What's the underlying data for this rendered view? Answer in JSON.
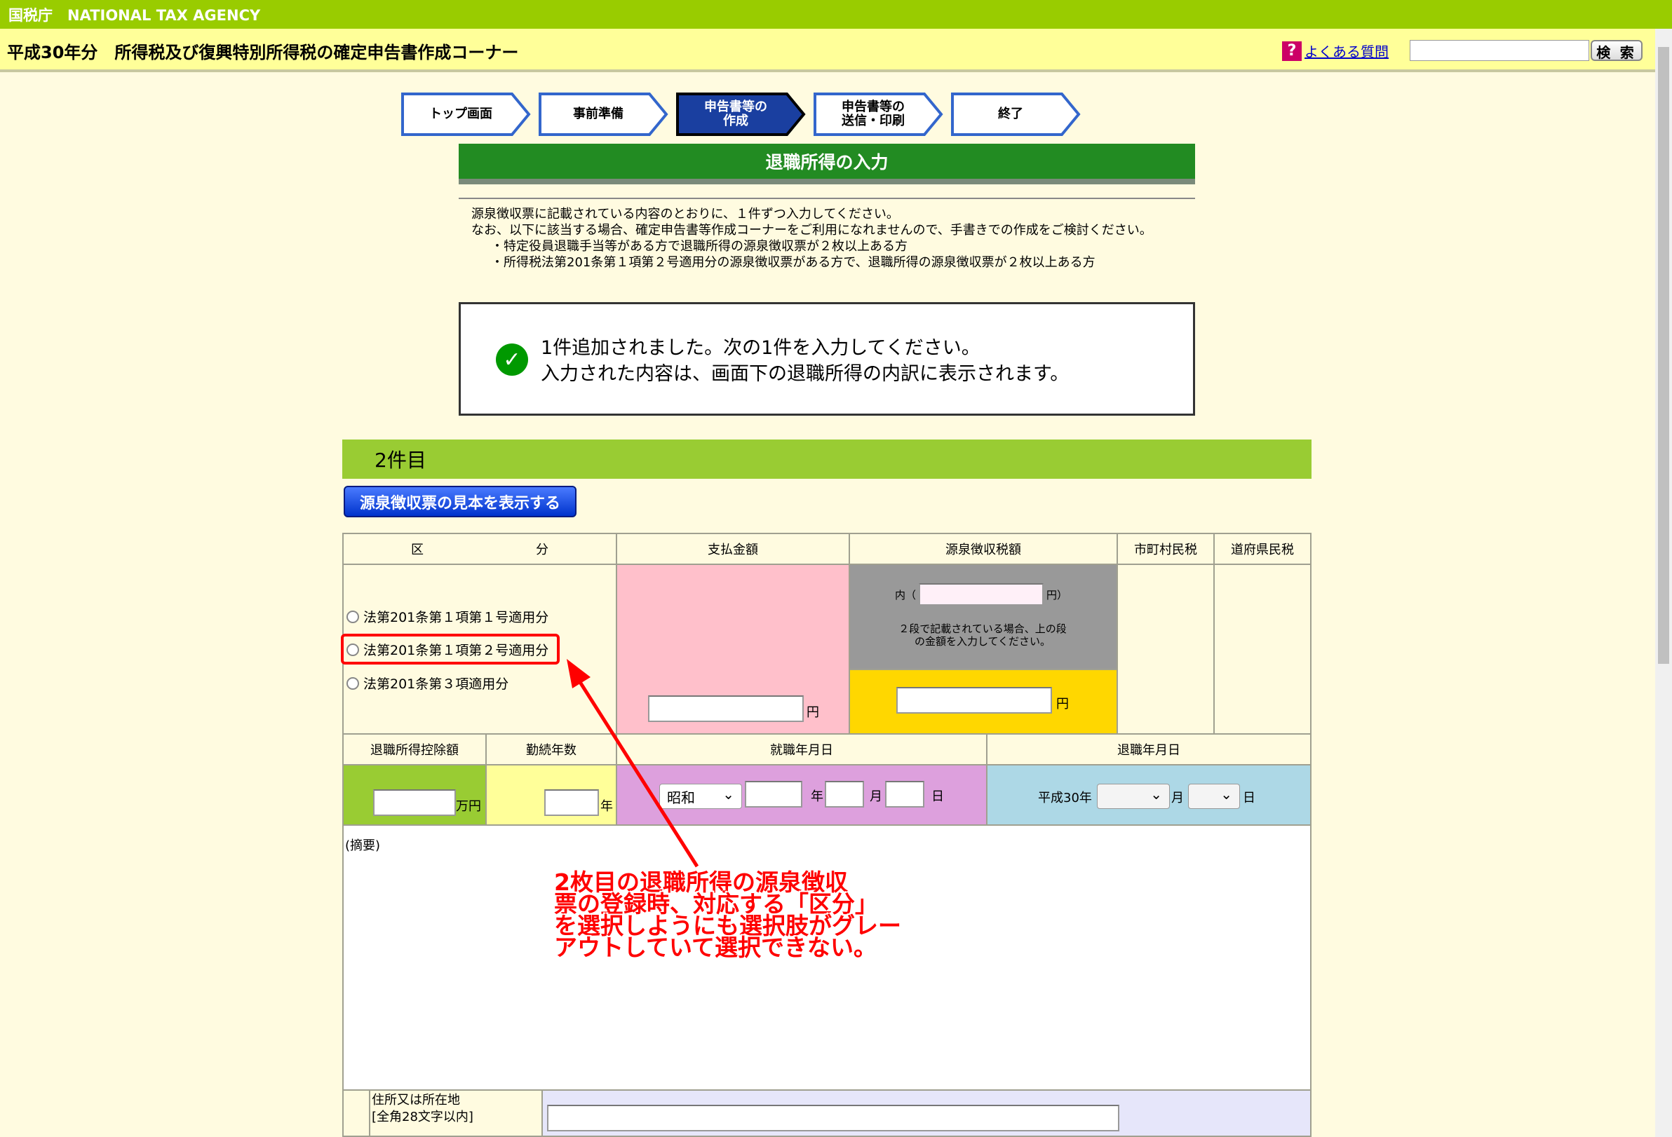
{
  "topbar": {
    "agency": "国税庁　NATIONAL TAX AGENCY"
  },
  "header": {
    "title": "平成30年分　所得税及び復興特別所得税の確定申告書作成コーナー",
    "faq_icon": "?",
    "faq_link": "よくある質問",
    "search_button": "検 索"
  },
  "steps": [
    {
      "label": "トップ画面",
      "active": false
    },
    {
      "label": "事前準備",
      "active": false
    },
    {
      "label": "申告書等の\n作成",
      "active": true
    },
    {
      "label": "申告書等の\n送信・印刷",
      "active": false
    },
    {
      "label": "終了",
      "active": false
    }
  ],
  "section_title": "退職所得の入力",
  "description": {
    "line1": "源泉徴収票に記載されている内容のとおりに、１件ずつ入力してください。",
    "line2": "なお、以下に該当する場合、確定申告書等作成コーナーをご利用になれませんので、手書きでの作成をご検討ください。",
    "bullet1": "・特定役員退職手当等がある方で退職所得の源泉徴収票が２枚以上ある方",
    "bullet2": "・所得税法第201条第１項第２号適用分の源泉徴収票がある方で、退職所得の源泉徴収票が２枚以上ある方"
  },
  "notice": {
    "icon": "check-icon",
    "line1": "1件追加されました。次の1件を入力してください。",
    "line2": "入力された内容は、画面下の退職所得の内訳に表示されます。"
  },
  "item_bar": "2件目",
  "sample_button": "源泉徴収票の見本を表示する",
  "table": {
    "headers": {
      "kubun_left": "区",
      "kubun_right": "分",
      "payment": "支払金額",
      "withholding": "源泉徴収税額",
      "municipal": "市町村民税",
      "prefectural": "道府県民税"
    },
    "radios": [
      "法第201条第１項第１号適用分",
      "法第201条第１項第２号適用分",
      "法第201条第３項適用分"
    ],
    "inner_prefix": "内（",
    "inner_suffix": "円）",
    "inner_note": "２段で記載されている場合、上の段の金額を入力してください。",
    "yen": "円",
    "headers2": {
      "deduction": "退職所得控除額",
      "years": "勤続年数",
      "hire_date": "就職年月日",
      "retire_date": "退職年月日"
    },
    "man_yen": "万円",
    "nen": "年",
    "tsuki": "月",
    "hi": "日",
    "era_selected": "昭和",
    "retire_year": "平成30年",
    "remarks_label": "(摘要)",
    "address_label": "住所又は所在地",
    "address_limit": "[全角28文字以内]"
  },
  "annotation": "2枚目の退職所得の源泉徴収\n票の登録時、対応する「区分」\nを選択しようにも選択肢がグレー\nアウトしていて選択できない。",
  "colors": {
    "topbar": "#99CC00",
    "header": "#FFFF99",
    "section_title": "#228B22",
    "payment_bg": "#FFC0CB",
    "withholding_bg": "#999999",
    "withholding_input_bg": "#FFD700",
    "deduction_bg": "#99CC33",
    "years_bg": "#FFFF99",
    "hire_bg": "#DDA0DD",
    "retire_bg": "#ADD8E6",
    "annotation": "#FF0000"
  }
}
